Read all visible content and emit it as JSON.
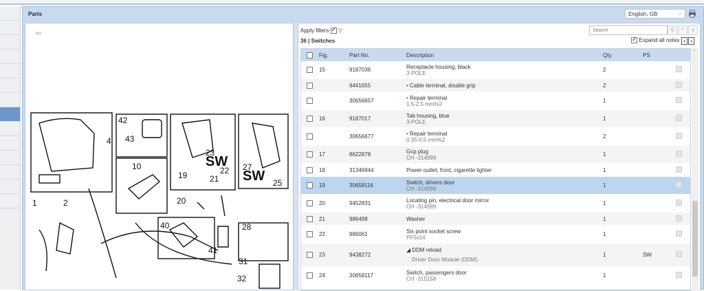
{
  "panel": {
    "title": "Parts",
    "language": "English, GB"
  },
  "filters": {
    "apply_label": "Apply filters",
    "apply_checked": true,
    "count": "36",
    "separator": "|",
    "group": "Switches",
    "search_placeholder": "Search",
    "expand_label": "Expand all notes",
    "expand_checked": true
  },
  "table": {
    "headers": [
      "Fig.",
      "Part No.",
      "Description",
      "Qty.",
      "PS"
    ],
    "rows": [
      {
        "fig": "15",
        "part": "9187036",
        "desc": "Receptacle housing, black",
        "sub": "3-POLE",
        "qty": "2",
        "ps": "",
        "bullet": false
      },
      {
        "fig": "",
        "part": "9441655",
        "desc": "Cable terminal, double grip",
        "sub": "",
        "qty": "2",
        "ps": "",
        "bullet": true
      },
      {
        "fig": "",
        "part": "30656657",
        "desc": "Repair terminal",
        "sub": "1.5-2.5 mm%2",
        "qty": "1",
        "ps": "",
        "bullet": true
      },
      {
        "fig": "16",
        "part": "9187017",
        "desc": "Tab housing, blue",
        "sub": "3-POLE",
        "qty": "1",
        "ps": "",
        "bullet": false
      },
      {
        "fig": "",
        "part": "30656677",
        "desc": "Repair terminal",
        "sub": "0.35-0.5 mm%2",
        "qty": "2",
        "ps": "",
        "bullet": true
      },
      {
        "fig": "17",
        "part": "8622878",
        "desc": "Gcp plug",
        "sub": "CH -314999",
        "qty": "1",
        "ps": "",
        "bullet": false
      },
      {
        "fig": "18",
        "part": "31346944",
        "desc": "Power outlet, front, cigarette lighter",
        "sub": "",
        "qty": "1",
        "ps": "",
        "bullet": false
      },
      {
        "fig": "19",
        "part": "30658116",
        "desc": "Switch, drivers door",
        "sub": "CH -314999",
        "qty": "1",
        "ps": "",
        "bullet": false,
        "selected": true
      },
      {
        "fig": "20",
        "part": "9452831",
        "desc": "Locating pin, electrical door mirror",
        "sub": "CH -314999",
        "qty": "1",
        "ps": "",
        "bullet": false
      },
      {
        "fig": "21",
        "part": "986498",
        "desc": "Washer",
        "sub": "",
        "qty": "1",
        "ps": "",
        "bullet": false
      },
      {
        "fig": "22",
        "part": "986061",
        "desc": "Six point socket screw",
        "sub": "PF5x14",
        "qty": "1",
        "ps": "",
        "bullet": false
      },
      {
        "fig": "23",
        "part": "9438272",
        "desc": "◢ DDM reload",
        "sub": "Driver Door Module (DDM).",
        "qty": "1",
        "ps": "SW",
        "bullet": false,
        "tall": true
      },
      {
        "fig": "24",
        "part": "30658117",
        "desc": "Switch, passengers door",
        "sub": "CH -315158",
        "qty": "1",
        "ps": "",
        "bullet": false
      }
    ]
  },
  "diagram": {
    "callouts": [
      "4",
      "42",
      "43",
      "10",
      "23",
      "SW",
      "27",
      "SW",
      "19",
      "21",
      "22",
      "20",
      "25",
      "1",
      "2",
      "40",
      "41",
      "28",
      "31",
      "32"
    ]
  }
}
